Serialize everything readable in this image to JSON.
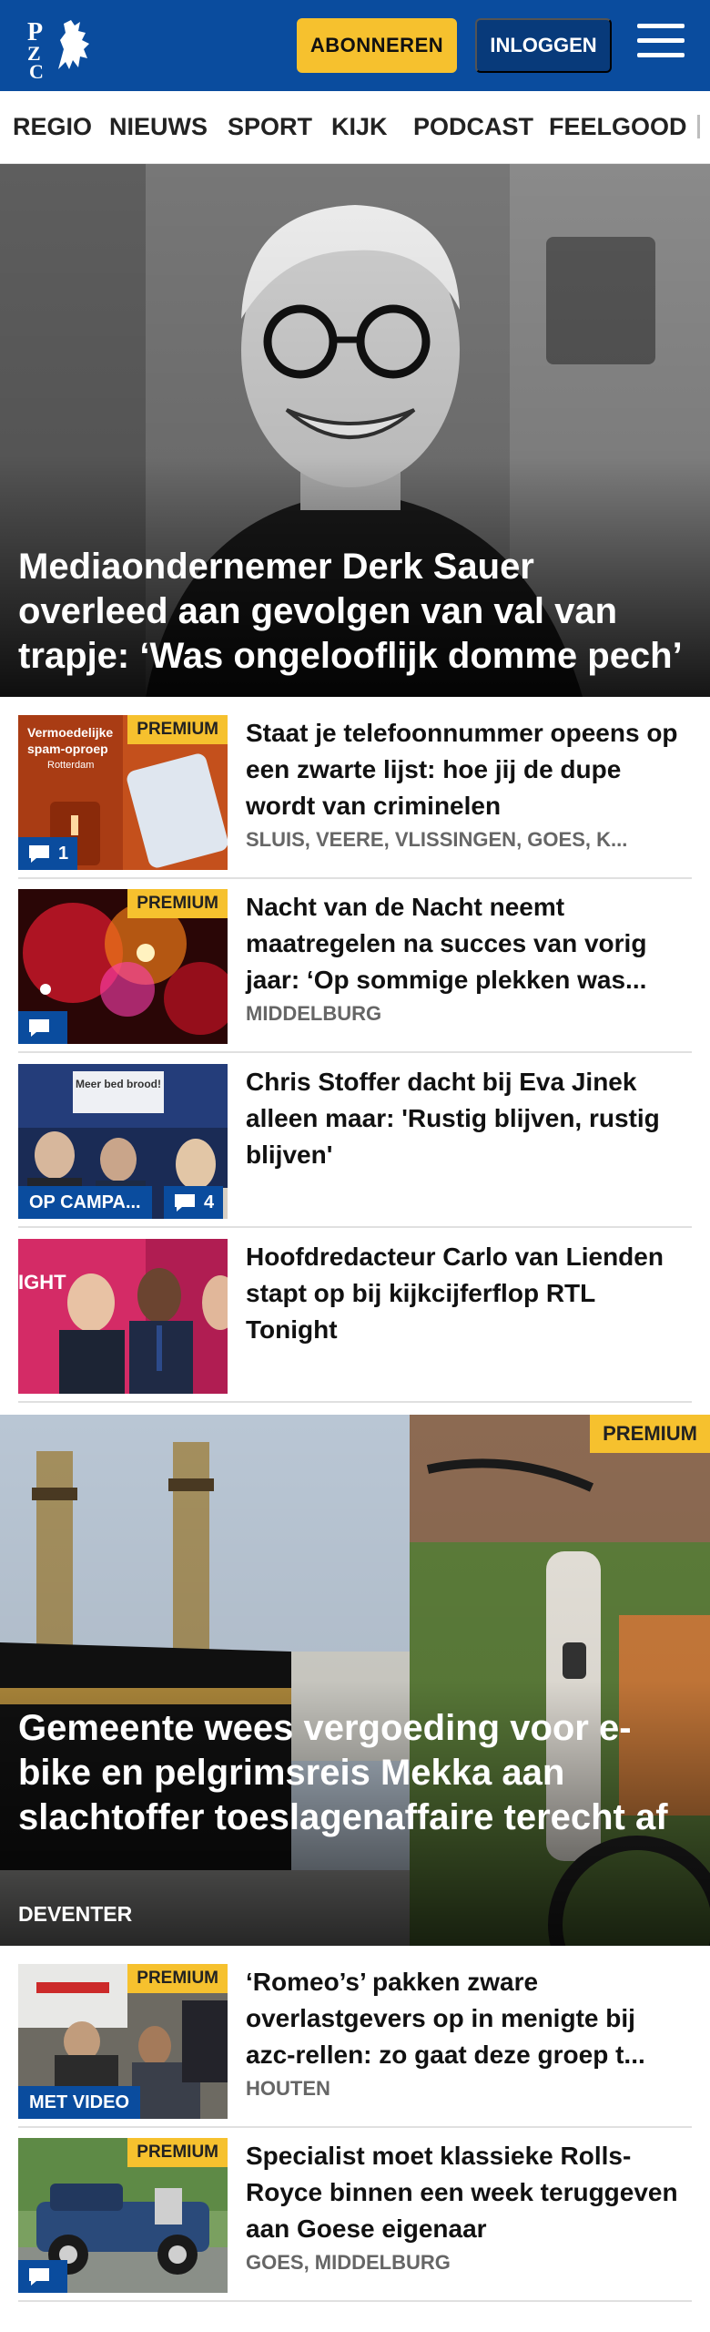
{
  "header": {
    "logo_text": "PZC",
    "subscribe_label": "ABONNEREN",
    "login_label": "INLOGGEN"
  },
  "nav": {
    "items": [
      "REGIO",
      "NIEUWS",
      "SPORT",
      "KIJK",
      "PODCAST",
      "FEELGOOD"
    ]
  },
  "hero": {
    "title": "Mediaondernemer Derk Sauer overleed aan gevolgen van val van trapje: ‘Was ongelooflijk domme pech’"
  },
  "articles": [
    {
      "title": "Staat je telefoonnummer opeens op een zwarte lijst: hoe jij de dupe wordt van criminelen",
      "meta": "SLUIS, VEERE, VLISSINGEN, GOES, K...",
      "badge": "PREMIUM",
      "comments": "1",
      "thumb_caption_1": "Vermoedelijke",
      "thumb_caption_2": "spam-oproep",
      "thumb_caption_3": "Rotterdam"
    },
    {
      "title": "Nacht van de Nacht neemt maatregelen na succes van vorig jaar: ‘Op sommige plekken was...",
      "meta": "MIDDELBURG",
      "badge": "PREMIUM",
      "comments": ""
    },
    {
      "title": "Chris Stoffer dacht bij Eva Jinek alleen maar: 'Rustig blijven, rustig blijven'",
      "meta": "",
      "label": "OP CAMPA...",
      "comments": "4",
      "sign_text": "Meer bed brood!"
    },
    {
      "title": "Hoofdredacteur Carlo van Lienden stapt op bij kijkcijferflop RTL Tonight",
      "meta": "",
      "thumb_text": "IGHT"
    }
  ],
  "feature": {
    "badge": "PREMIUM",
    "title": "Gemeente wees vergoeding voor e-bike en pelgrimsreis Mekka aan slachtoffer toeslagenaffaire terecht af",
    "meta": "DEVENTER"
  },
  "articles_bottom": [
    {
      "title": "‘Romeo’s’ pakken zware overlastgevers op in menigte bij azc-rellen: zo gaat deze groep t...",
      "meta": "HOUTEN",
      "badge": "PREMIUM",
      "label": "MET VIDEO"
    },
    {
      "title": "Specialist moet klassieke Rolls-Royce binnen een week teruggeven aan Goese eigenaar",
      "meta": "GOES, MIDDELBURG",
      "badge": "PREMIUM",
      "comments": ""
    }
  ],
  "colors": {
    "brand_blue": "#0a4c9e",
    "premium_yellow": "#f6c12e"
  }
}
